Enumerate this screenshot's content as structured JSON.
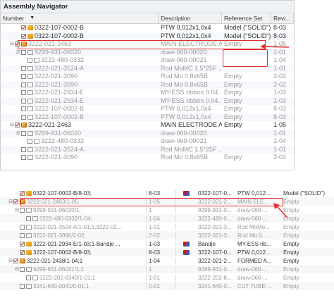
{
  "navigator": {
    "title": "Assembly Navigator",
    "columns": {
      "number": "Number",
      "description": "Description",
      "reference_set": "Reference Set",
      "revision": "Revi..."
    },
    "rows": [
      {
        "indent": 2,
        "expander": "",
        "checked": true,
        "icon": "part",
        "number": "0322-107-0002-B",
        "description": "PTW 0,012x1,0x4",
        "ref_set": "Model (\"SOLID\")",
        "rev": "8-03",
        "grey": false
      },
      {
        "indent": 2,
        "expander": "",
        "checked": true,
        "icon": "part",
        "number": "0322-107-0002-B",
        "description": "PTW 0,012x1,0x4",
        "ref_set": "Model (\"SOLID\")",
        "rev": "8-03",
        "grey": false
      },
      {
        "indent": 1,
        "expander": "⊟",
        "checked": true,
        "icon": "asm",
        "number": "3222-021-2463",
        "description": "MAIN ELECTRODE AS...",
        "ref_set": "Empty",
        "rev": "1-05",
        "grey": true
      },
      {
        "indent": 2,
        "expander": "⊟",
        "checked": false,
        "icon": "ghost",
        "number": "9299-931-06020",
        "description": "draw-060-00020",
        "ref_set": "",
        "rev": "1-01",
        "grey": true
      },
      {
        "indent": 3,
        "expander": "",
        "checked": false,
        "icon": "ghost",
        "number": "3222-480-0332",
        "description": "draw-060-00021",
        "ref_set": "",
        "rev": "1-04",
        "grey": true
      },
      {
        "indent": 2,
        "expander": "",
        "checked": false,
        "icon": "ghost",
        "number": "3222-021-3524-A",
        "description": "Rod MoMC 1.5*25F ...",
        "ref_set": "",
        "rev": "1-01",
        "grey": true
      },
      {
        "indent": 2,
        "expander": "",
        "checked": false,
        "icon": "ghost",
        "number": "3222-021-3090",
        "description": "Rod Mo 0.8x65B",
        "ref_set": "Empty",
        "rev": "2-02",
        "grey": true
      },
      {
        "indent": 2,
        "expander": "",
        "checked": false,
        "icon": "ghost",
        "number": "3222-021-3090",
        "description": "Rod Mo 0.8x65B",
        "ref_set": "Empty",
        "rev": "2-02",
        "grey": true
      },
      {
        "indent": 2,
        "expander": "",
        "checked": false,
        "icon": "ghost",
        "number": "3222-021-2934-E",
        "description": "MY-ESS ribbon 0.04...",
        "ref_set": "Empty",
        "rev": "1-03",
        "grey": true
      },
      {
        "indent": 2,
        "expander": "",
        "checked": false,
        "icon": "ghost",
        "number": "3222-021-2934-E",
        "description": "MY-ESS ribbon 0.04...",
        "ref_set": "Empty",
        "rev": "1-03",
        "grey": true
      },
      {
        "indent": 2,
        "expander": "",
        "checked": false,
        "icon": "ghost",
        "number": "3222-107-0002-B",
        "description": "PTW 0,012x1,0x4",
        "ref_set": "Empty",
        "rev": "8-03",
        "grey": true
      },
      {
        "indent": 2,
        "expander": "",
        "checked": false,
        "icon": "ghost",
        "number": "3222-107-0002-B",
        "description": "PTW 0,012x1,0x4",
        "ref_set": "Empty",
        "rev": "8-03",
        "grey": true
      },
      {
        "indent": 1,
        "expander": "⊟",
        "checked": true,
        "icon": "asm",
        "number": "3222-021-2463",
        "description": "MAIN ELECTRODE AS...",
        "ref_set": "Empty",
        "rev": "1-05",
        "grey": false
      },
      {
        "indent": 2,
        "expander": "⊟",
        "checked": false,
        "icon": "ghost",
        "number": "9299-931-06020",
        "description": "draw-060-00020",
        "ref_set": "",
        "rev": "1-01",
        "grey": true
      },
      {
        "indent": 3,
        "expander": "",
        "checked": false,
        "icon": "ghost",
        "number": "3222-480-0332",
        "description": "draw-060-00021",
        "ref_set": "",
        "rev": "1-04",
        "grey": true
      },
      {
        "indent": 2,
        "expander": "",
        "checked": false,
        "icon": "ghost",
        "number": "3222-021-3524-A",
        "description": "Rod MoMC 1.5*25F ...",
        "ref_set": "",
        "rev": "1-01",
        "grey": true
      },
      {
        "indent": 2,
        "expander": "",
        "checked": false,
        "icon": "ghost",
        "number": "3222-021-3090",
        "description": "Rod Mo 0.8x65B",
        "ref_set": "Empty",
        "rev": "2-02",
        "grey": true
      }
    ]
  },
  "list2": {
    "rows": [
      {
        "indent": 2,
        "expander": "",
        "checked": true,
        "icon": "part",
        "number": "0322-107-0002-B/8-03;",
        "rev": "8-03",
        "flag": true,
        "ref": "0322-107-0...",
        "desc": "PTW 0,012...",
        "refset": "Model (\"SOLID\")",
        "grey": false
      },
      {
        "indent": 1,
        "expander": "⊟",
        "checked": true,
        "icon": "asm",
        "number": "3222-021-2463/1-05;",
        "rev": "1-05",
        "flag": false,
        "ref": "3222-021-2...",
        "desc": "MAIN ELE...",
        "refset": "Empty",
        "grey": true
      },
      {
        "indent": 2,
        "expander": "⊟",
        "checked": false,
        "icon": "ghost",
        "number": "9299-931-06020/1;",
        "rev": "1",
        "flag": false,
        "ref": "9299-931-0...",
        "desc": "draw-060-...",
        "refset": "Empty",
        "grey": true
      },
      {
        "indent": 3,
        "expander": "",
        "checked": false,
        "icon": "ghost",
        "number": "3222-480-0332/1-04;",
        "rev": "1-04",
        "flag": false,
        "ref": "3222-480-0...",
        "desc": "draw-060-...",
        "refset": "Empty",
        "grey": true
      },
      {
        "indent": 2,
        "expander": "",
        "checked": false,
        "icon": "ghost",
        "number": "3222-021-3524-A/1-01;1;3222-02...",
        "rev": "1-01",
        "flag": false,
        "ref": "3222-021-3...",
        "desc": "Rod MoMo...",
        "refset": "Empty",
        "grey": true
      },
      {
        "indent": 2,
        "expander": "",
        "checked": false,
        "icon": "ghost",
        "number": "3222-021-3090/2-02;",
        "rev": "2-02",
        "flag": false,
        "ref": "3222-021-3...",
        "desc": "Rod Mo 0...",
        "refset": "Empty",
        "grey": true
      },
      {
        "indent": 2,
        "expander": "",
        "checked": true,
        "icon": "part",
        "number": "3222-021-2934-E/1-03;1-Bandje ...",
        "rev": "1-03",
        "flag": true,
        "ref": "Bandje",
        "desc": "MY-ESS rib...",
        "refset": "Empty",
        "grey": false
      },
      {
        "indent": 2,
        "expander": "",
        "checked": true,
        "icon": "part",
        "number": "3222-107-0002-B/8-03;",
        "rev": "8-03",
        "flag": true,
        "ref": "3222-107-0...",
        "desc": "PTW 0,012...",
        "refset": "Empty",
        "grey": false
      },
      {
        "indent": 1,
        "expander": "⊟",
        "checked": true,
        "icon": "asm",
        "number": "3222-021-2438/1-04;1",
        "rev": "1-04",
        "flag": false,
        "ref": "3222-021-2...",
        "desc": "FORMED A...",
        "refset": "Empty",
        "grey": false
      },
      {
        "indent": 2,
        "expander": "⊟",
        "checked": false,
        "icon": "ghost",
        "number": "9299-931-06031/1;1",
        "rev": "1",
        "flag": false,
        "ref": "9299-931-0...",
        "desc": "draw-060-...",
        "refset": "Empty",
        "grey": true
      },
      {
        "indent": 3,
        "expander": "",
        "checked": false,
        "icon": "ghost",
        "number": "3222-202-8349/1-01;1",
        "rev": "1-01",
        "flag": false,
        "ref": "3222-202-8...",
        "desc": "draw-060-...",
        "refset": "Empty",
        "grey": true
      },
      {
        "indent": 2,
        "expander": "",
        "checked": false,
        "icon": "ghost",
        "number": "3241-640-0041/0-01;1",
        "rev": "0-01",
        "flag": false,
        "ref": "3241-640-0...",
        "desc": "CUT TUBE-...",
        "refset": "Empty",
        "grey": true
      }
    ]
  },
  "colors": {
    "highlight": "#e03030",
    "check": "#c0281c"
  }
}
